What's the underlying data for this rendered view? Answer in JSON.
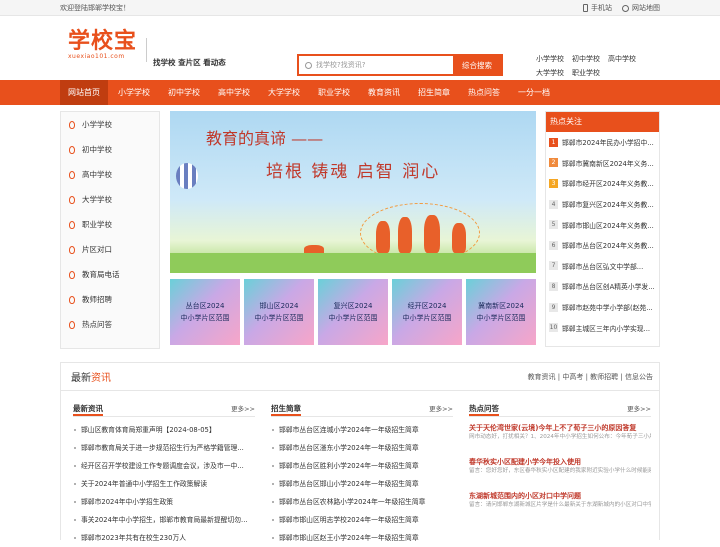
{
  "topbar": {
    "welcome": "欢迎登陆邯郸学校宝！",
    "phone": "手机站",
    "sitemap": "网站地图"
  },
  "logo": {
    "title": "学校宝",
    "domain": "xuexiao101.com"
  },
  "slogan": "找学校  查片区  看动态",
  "search": {
    "placeholder": "找学校?找资讯?",
    "button": "综合搜索"
  },
  "quick_links": [
    [
      "小学学校",
      "初中学校",
      "高中学校"
    ],
    [
      "大学学校",
      "职业学校"
    ]
  ],
  "nav": [
    "网站首页",
    "小学学校",
    "初中学校",
    "高中学校",
    "大学学校",
    "职业学校",
    "教育资讯",
    "招生简章",
    "热点问答",
    "一分一档"
  ],
  "sidenav": [
    "小学学校",
    "初中学校",
    "高中学校",
    "大学学校",
    "职业学校",
    "片区对口",
    "教育局电话",
    "教师招聘",
    "热点问答"
  ],
  "banner": {
    "line1": "教育的真谛 ——",
    "line2": "培根  铸魂  启智  润心"
  },
  "district_cards": [
    {
      "l1": "丛台区2024",
      "l2": "中小学片区范围"
    },
    {
      "l1": "邯山区2024",
      "l2": "中小学片区范围"
    },
    {
      "l1": "复兴区2024",
      "l2": "中小学片区范围"
    },
    {
      "l1": "经开区2024",
      "l2": "中小学片区范围"
    },
    {
      "l1": "冀南新区2024",
      "l2": "中小学片区范围"
    }
  ],
  "hot": {
    "title": "热点关注",
    "items": [
      {
        "n": "1",
        "t": "邯郸市2024年民办小学招中..."
      },
      {
        "n": "2",
        "t": "邯郸市冀南新区2024年义务..."
      },
      {
        "n": "3",
        "t": "邯郸市经开区2024年义务教..."
      },
      {
        "n": "4",
        "t": "邯郸市复兴区2024年义务教..."
      },
      {
        "n": "5",
        "t": "邯郸市邯山区2024年义务教..."
      },
      {
        "n": "6",
        "t": "邯郸市丛台区2024年义务教..."
      },
      {
        "n": "7",
        "t": "邯郸市丛台区弘文中学部..."
      },
      {
        "n": "8",
        "t": "邯郸市丛台区创A精英小学发..."
      },
      {
        "n": "9",
        "t": "邯郸市赵苑中学小学部(赵苑..."
      },
      {
        "n": "10",
        "t": "邯郸主城区三年内小学实现..."
      }
    ]
  },
  "news": {
    "title_a": "最新",
    "title_b": "资讯",
    "links": "教育资讯  |  中高考  |  教师招聘  |  信息公告",
    "col1": {
      "title": "最新资讯",
      "more": "更多>>",
      "items": [
        "邯山区教育体育局郑重声明【2024-08-05】",
        "邯郸市教育局关于进一步规范招生行为严格学籍管理...",
        "经开区召开学校建设工作专题调度会议，涉及市一中...",
        "关于2024年普通中小学招生工作政策解读",
        "邯郸市2024年中小学招生政策",
        "事关2024年中小学招生，邯郸市教育局最新提醒切勿...",
        "邯郸市2023年共有在校生230万人"
      ]
    },
    "col2": {
      "title": "招生简章",
      "more": "更多>>",
      "items": [
        "邯郸市丛台区连城小学2024年一年级招生简章",
        "邯郸市丛台区滏东小学2024年一年级招生简章",
        "邯郸市丛台区胜利小学2024年一年级招生简章",
        "邯郸市丛台区邯山小学2024年一年级招生简章",
        "邯郸市丛台区农林路小学2024年一年级招生简章",
        "邯郸市邯山区明志学校2024年一年级招生简章",
        "邯郸市邯山区赵王小学2024年一年级招生简章"
      ]
    },
    "col3": {
      "title": "热点问答",
      "more": "更多>>",
      "items": [
        {
          "q": "关于天伦湾世家(云境)今年上不了荀子三小的原因答复",
          "a": "网市动态好，打扰相关？1、2024年中小学招生如何公布：今年荀子三小片内包含了天伦湾世家（云境）...从目前我天伦湾的购房合"
        },
        {
          "q": "春华秋实小区配建小学今年投入使用",
          "a": "留言：您好您好，东区春华秋实小区配建的我家附近实验小学什么时候能建好了？什么时候可以招生？邯郸市教育局回复：尊敬的您好！春华秋实"
        },
        {
          "q": "东湖新城范围内的小区对口中学问题",
          "a": "留言：请问邯郸东湖新城区片学是什么最新关于东湖新城内的小区对口中学问题 ..."
        }
      ]
    }
  },
  "colors": {
    "brand": "#e8501c"
  }
}
